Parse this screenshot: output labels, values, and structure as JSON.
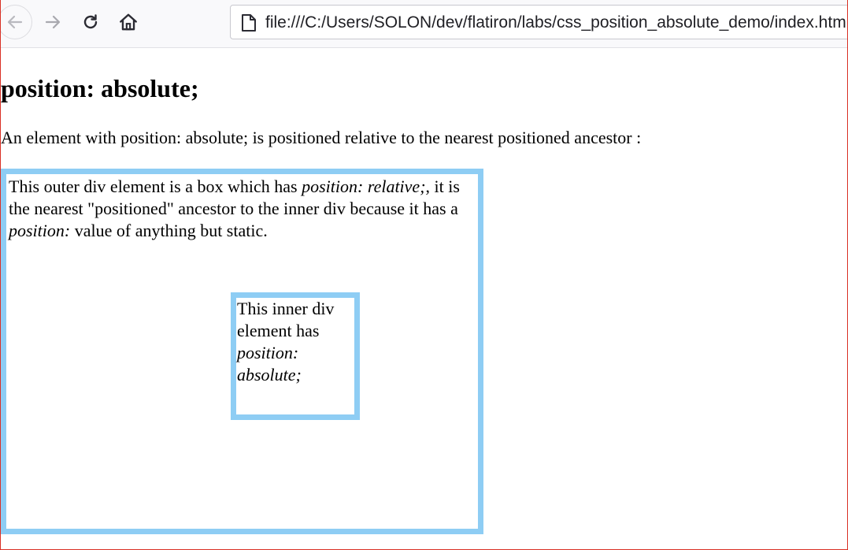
{
  "browser": {
    "url": "file:///C:/Users/SOLON/dev/flatiron/labs/css_position_absolute_demo/index.html",
    "icons": {
      "back": "back-arrow-icon",
      "forward": "forward-arrow-icon",
      "reload": "reload-icon",
      "home": "home-icon",
      "page": "page-icon"
    }
  },
  "page": {
    "heading": "position: absolute;",
    "intro": "An element with position: absolute; is positioned relative to the nearest positioned ancestor :",
    "outer": {
      "text_1": "This outer div element is a box which has ",
      "em_1": "position: relative;",
      "text_2": ", it is the nearest \"positioned\" ancestor to the inner div because it has a ",
      "em_2": "position:",
      "text_3": " value of anything but static."
    },
    "inner": {
      "text_1": "This inner div element has ",
      "em_1": "position: absolute;"
    }
  },
  "colors": {
    "box_border": "#8ecdf4",
    "window_border": "#d93025"
  }
}
